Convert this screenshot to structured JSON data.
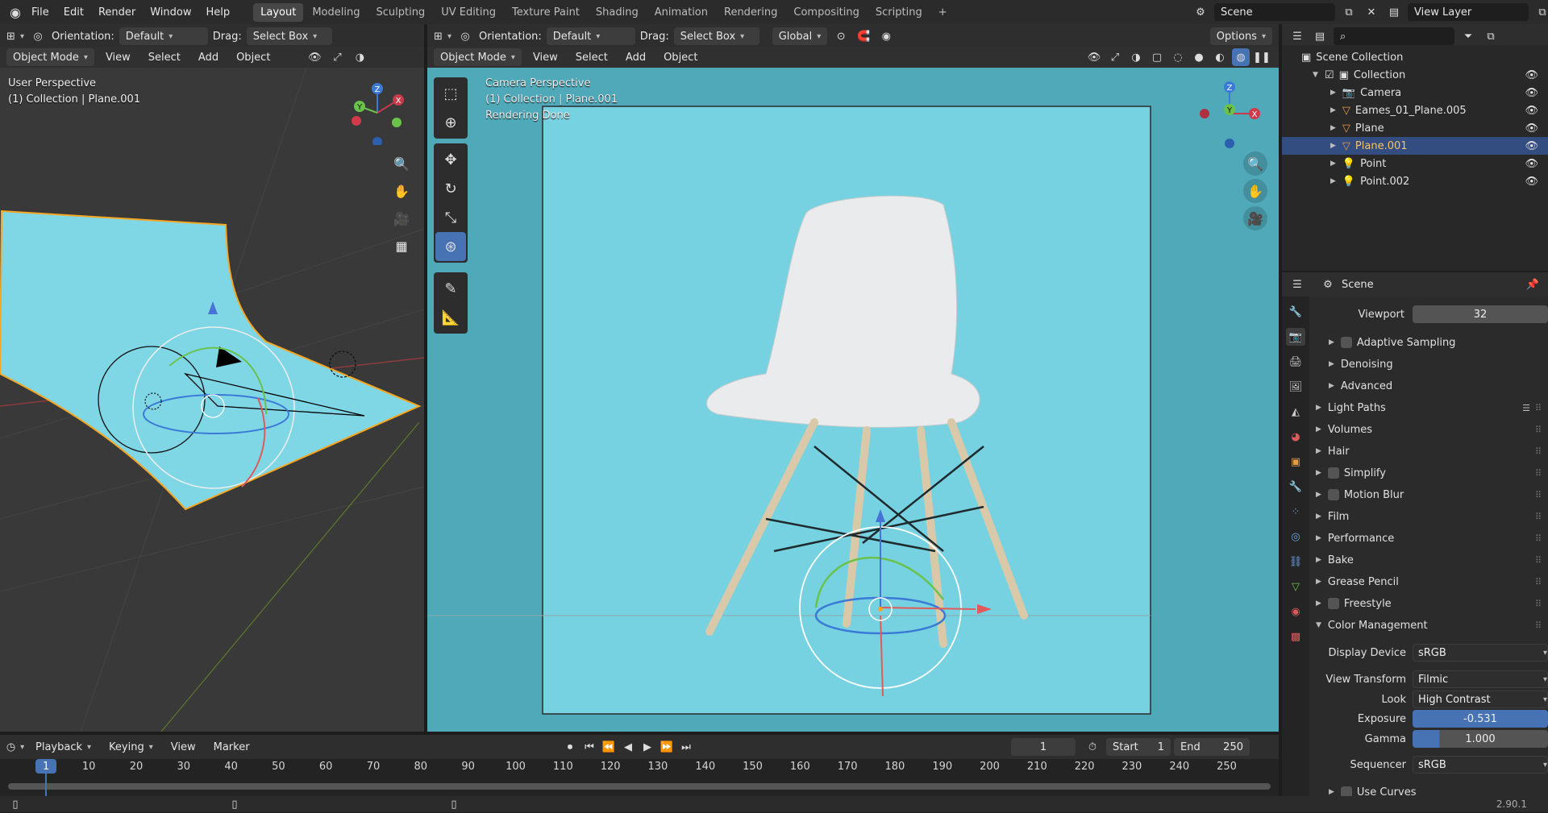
{
  "topbar": {
    "menus": [
      "File",
      "Edit",
      "Render",
      "Window",
      "Help"
    ],
    "workspaces": [
      "Layout",
      "Modeling",
      "Sculpting",
      "UV Editing",
      "Texture Paint",
      "Shading",
      "Animation",
      "Rendering",
      "Compositing",
      "Scripting"
    ],
    "active_workspace": "Layout",
    "add_tab": "+",
    "scene": "Scene",
    "view_layer": "View Layer"
  },
  "left_viewport": {
    "orientation_label": "Orientation:",
    "orientation_value": "Default",
    "drag_label": "Drag:",
    "drag_value": "Select Box",
    "mode": "Object Mode",
    "menus": [
      "View",
      "Select",
      "Add",
      "Object"
    ],
    "overlay_line1": "User Perspective",
    "overlay_line2": "(1) Collection | Plane.001",
    "gizmo": {
      "z": "Z",
      "y": "Y",
      "x": "X"
    }
  },
  "main_viewport": {
    "orientation_label": "Orientation:",
    "orientation_value": "Default",
    "drag_label": "Drag:",
    "drag_value": "Select Box",
    "transform": "Global",
    "options": "Options",
    "mode": "Object Mode",
    "menus": [
      "View",
      "Select",
      "Add",
      "Object"
    ],
    "overlay_line1": "Camera Perspective",
    "overlay_line2": "(1) Collection | Plane.001",
    "overlay_line3": "Rendering Done",
    "gizmo": {
      "z": "Z",
      "y": "Y",
      "x": "X"
    }
  },
  "outliner": {
    "root": "Scene Collection",
    "collection": "Collection",
    "items": [
      {
        "name": "Camera",
        "selected": false
      },
      {
        "name": "Eames_01_Plane.005",
        "selected": false
      },
      {
        "name": "Plane",
        "selected": false
      },
      {
        "name": "Plane.001",
        "selected": true
      },
      {
        "name": "Point",
        "selected": false
      },
      {
        "name": "Point.002",
        "selected": false
      }
    ]
  },
  "properties": {
    "context": "Scene",
    "viewport_label": "Viewport",
    "viewport_value": "32",
    "sub_panels": [
      "Adaptive Sampling",
      "Denoising",
      "Advanced"
    ],
    "panels": [
      "Light Paths",
      "Volumes",
      "Hair",
      "Simplify",
      "Motion Blur",
      "Film",
      "Performance",
      "Bake",
      "Grease Pencil",
      "Freestyle",
      "Color Management"
    ],
    "color_management": {
      "display_device_label": "Display Device",
      "display_device": "sRGB",
      "view_transform_label": "View Transform",
      "view_transform": "Filmic",
      "look_label": "Look",
      "look": "High Contrast",
      "exposure_label": "Exposure",
      "exposure": "-0.531",
      "gamma_label": "Gamma",
      "gamma": "1.000",
      "sequencer_label": "Sequencer",
      "sequencer": "sRGB",
      "use_curves": "Use Curves"
    }
  },
  "timeline": {
    "menus": [
      "Playback",
      "Keying",
      "View",
      "Marker"
    ],
    "current_frame": "1",
    "start_label": "Start",
    "start": "1",
    "end_label": "End",
    "end": "250",
    "ticks": [
      "1",
      "10",
      "20",
      "30",
      "40",
      "50",
      "60",
      "70",
      "80",
      "90",
      "100",
      "110",
      "120",
      "130",
      "140",
      "150",
      "160",
      "170",
      "180",
      "190",
      "200",
      "210",
      "220",
      "230",
      "240",
      "250"
    ]
  },
  "status": {
    "version": "2.90.1"
  },
  "colors": {
    "accent": "#4772b3",
    "selection_outline": "#f5a623",
    "backdrop": "#5ebccc"
  }
}
